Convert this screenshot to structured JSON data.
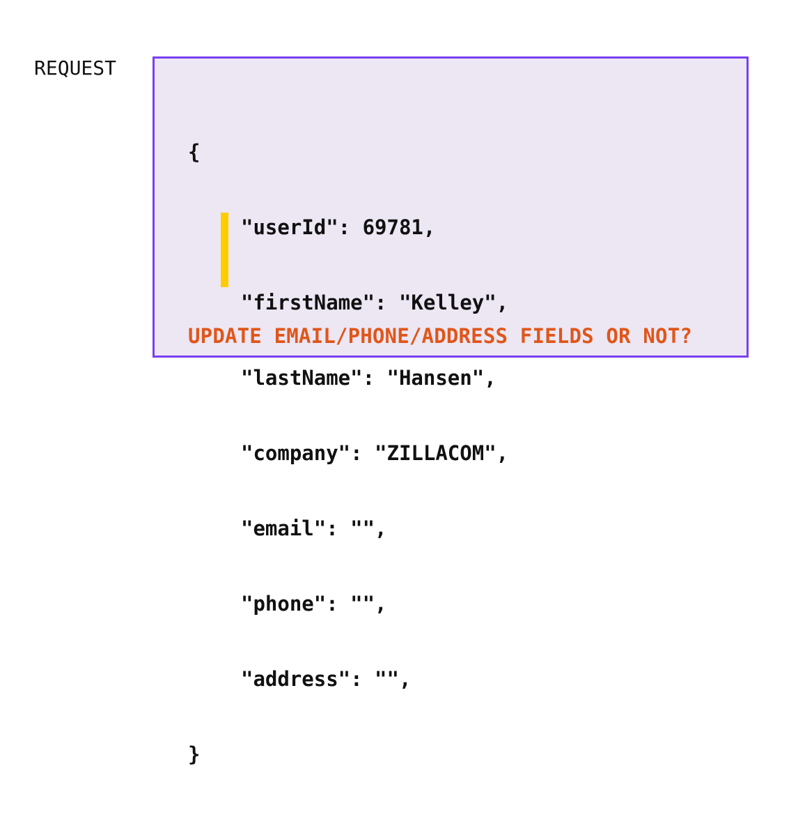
{
  "request_label": "REQUEST",
  "colors": {
    "box_border": "#7a3ff0",
    "box_background": "#ede7f4",
    "highlight": "#ffcc00",
    "question_text": "#e0561a"
  },
  "code": {
    "open_brace": "{",
    "lines": [
      "\"userId\": 69781,",
      "\"firstName\": \"Kelley\",",
      "\"lastName\": \"Hansen\",",
      "\"company\": \"ZILLACOM\",",
      "\"email\": \"\",",
      "\"phone\": \"\",",
      "\"address\": \"\","
    ],
    "close_brace": "}"
  },
  "question": "UPDATE EMAIL/PHONE/ADDRESS FIELDS OR NOT?"
}
